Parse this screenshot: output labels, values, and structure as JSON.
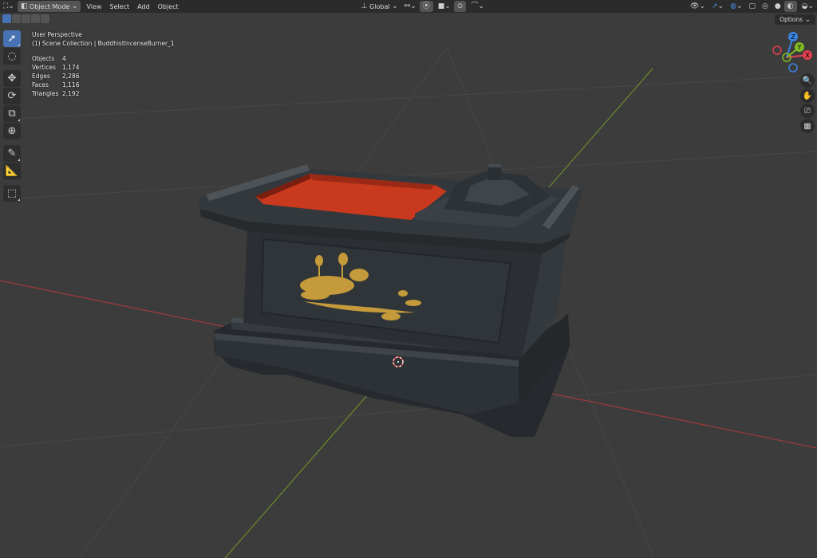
{
  "header": {
    "editor_type_icon": "3d-viewport-icon",
    "mode": "Object Mode",
    "menus": [
      "View",
      "Select",
      "Add",
      "Object"
    ],
    "transform_orientation": "Global",
    "pivot_icon": "pivot-icon",
    "snap_icon": "snap-icon",
    "proportional_icon": "proportional-edit-icon"
  },
  "options_label": "Options",
  "overlay": {
    "view_name": "User Perspective",
    "collection": "(1) Scene Collection | BuddhistIncenseBurner_1"
  },
  "stats": [
    {
      "label": "Objects",
      "value": "4"
    },
    {
      "label": "Vertices",
      "value": "1,174"
    },
    {
      "label": "Edges",
      "value": "2,286"
    },
    {
      "label": "Faces",
      "value": "1,116"
    },
    {
      "label": "Triangles",
      "value": "2,192"
    }
  ],
  "gizmo": {
    "x_label": "X",
    "y_label": "Y",
    "z_label": "Z",
    "x_color": "#e0404f",
    "y_color": "#7fba24",
    "z_color": "#3a83e0"
  },
  "tools": [
    "select-box-icon",
    "cursor-icon",
    "move-icon",
    "rotate-icon",
    "scale-icon",
    "transform-icon",
    "annotate-icon",
    "measure-icon",
    "add-cube-icon"
  ],
  "nav": [
    "zoom-icon",
    "pan-hand-icon",
    "camera-icon",
    "grid-view-icon"
  ],
  "colors": {
    "background": "#3c3c3c",
    "header": "#2b2b2b",
    "active_tool": "#4772b3",
    "x_axis_line": "#a33a3a",
    "y_axis_line": "#6b8a2a",
    "lacquer_red": "#c8391e",
    "gold_motif": "#c49a3a",
    "wood_dark": "#2f3438"
  }
}
